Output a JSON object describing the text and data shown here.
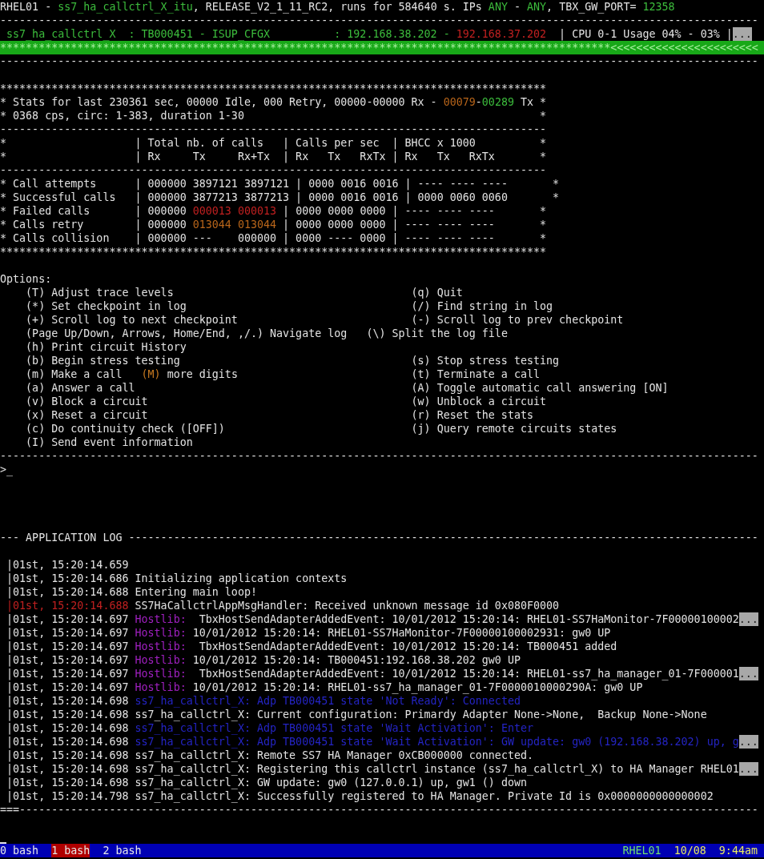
{
  "lines": [
    {
      "kind": "header",
      "segments": [
        {
          "text": "RHEL01 - "
        },
        {
          "text": "ss7_ha_callctrl_X_itu",
          "color": "#3cbc3c"
        },
        {
          "text": ", RELEASE_V2_1_11_RC2, runs for 584640 s. IPs "
        },
        {
          "text": "ANY",
          "color": "#3cbc3c"
        },
        {
          "text": " - "
        },
        {
          "text": "ANY",
          "color": "#3cbc3c"
        },
        {
          "text": ", TBX_GW_PORT= "
        },
        {
          "text": "12358",
          "color": "#3cbc3c"
        }
      ]
    },
    {
      "kind": "separator",
      "segments": [
        {
          "text": "----------------------------------------------------------------------------------------------------------------------"
        }
      ]
    },
    {
      "kind": "status",
      "segments": [
        {
          "text": "ss7_ha_callctrl_X  : TB000451 - ISUP_CFGX",
          "color": "#3cbc3c"
        },
        {
          "text": "          : 192.168.38.202 - ",
          "color": "#3cbc3c"
        },
        {
          "text": "192.168.37.202",
          "color": "#c02020"
        },
        {
          "text": "  | CPU 0-1 Usage 04% - 03% |"
        }
      ],
      "more": "..."
    },
    {
      "kind": "banner",
      "segments": [
        {
          "text": "***********************************************************************************************<<<<<<<<<<<<<<<<<<<<<<<"
        }
      ]
    },
    {
      "kind": "separator",
      "segments": [
        {
          "text": "----------------------------------------------------------------------------------------------------------------------"
        }
      ]
    },
    {
      "kind": "blank"
    },
    {
      "kind": "border",
      "segments": [
        {
          "text": "*************************************************************************************"
        }
      ]
    },
    {
      "kind": "stats",
      "segments": [
        {
          "text": "* Stats for last 230361 sec, 00000 Idle, 000 Retry, 00000-00000 Rx - "
        },
        {
          "text": "00079",
          "color": "#b8651a"
        },
        {
          "text": "-"
        },
        {
          "text": "00289",
          "color": "#3cbc3c"
        },
        {
          "text": " Tx *"
        }
      ]
    },
    {
      "kind": "stats",
      "segments": [
        {
          "text": "* 0368 cps, circ: 1-383, duration 1-30                                              *"
        }
      ]
    },
    {
      "kind": "separator",
      "segments": [
        {
          "text": "-------------------------------------------------------------------------------------"
        }
      ]
    },
    {
      "kind": "table_header",
      "segments": [
        {
          "text": "*                    | Total nb. of calls   | Calls per sec  | BHCC x 1000          *"
        }
      ]
    },
    {
      "kind": "table_header",
      "segments": [
        {
          "text": "*                    | Rx     Tx     Rx+Tx  | Rx   Tx   RxTx | Rx   Tx   RxTx       *"
        }
      ]
    },
    {
      "kind": "separator",
      "segments": [
        {
          "text": "-------------------------------------------------------------------------------------"
        }
      ]
    },
    {
      "kind": "table_row",
      "segments": [
        {
          "text": "* Call attempts      | 000000 3897121 3897121 | 0000 0016 0016 | ---- ---- ----       *"
        }
      ]
    },
    {
      "kind": "table_row",
      "segments": [
        {
          "text": "* Successful calls   | 000000 3877213 3877213 | 0000 0016 0016 | 0000 0060 0060       *"
        }
      ]
    },
    {
      "kind": "table_row",
      "segments": [
        {
          "text": "* Failed calls       | 000000 "
        },
        {
          "text": "000013 000013",
          "color": "#c02020"
        },
        {
          "text": " | 0000 0000 0000 | ---- ---- ----       *"
        }
      ]
    },
    {
      "kind": "table_row",
      "segments": [
        {
          "text": "* Calls retry        | 000000 "
        },
        {
          "text": "013044 013044",
          "color": "#b8651a"
        },
        {
          "text": " | 0000 0000 0000 | ---- ---- ----       *"
        }
      ]
    },
    {
      "kind": "table_row",
      "segments": [
        {
          "text": "* Calls collision    | 000000 ---    000000 | 0000 ---- 0000 | ---- ---- ----       *"
        }
      ]
    },
    {
      "kind": "border",
      "segments": [
        {
          "text": "*************************************************************************************"
        }
      ]
    },
    {
      "kind": "blank"
    },
    {
      "kind": "options_title",
      "segments": [
        {
          "text": "Options:"
        }
      ]
    },
    {
      "kind": "option",
      "left": [
        [
          {
            "text": "(T) Adjust trace levels"
          }
        ]
      ],
      "right": [
        [
          {
            "text": "(q) Quit"
          }
        ]
      ]
    },
    {
      "kind": "option",
      "left": [
        [
          {
            "text": "(*) Set checkpoint in log"
          }
        ]
      ],
      "right": [
        [
          {
            "text": "(/) Find string in log"
          }
        ]
      ]
    },
    {
      "kind": "option",
      "left": [
        [
          {
            "text": "(+) Scroll log to next checkpoint"
          }
        ]
      ],
      "right": [
        [
          {
            "text": "(-) Scroll log to prev checkpoint"
          }
        ]
      ]
    },
    {
      "kind": "option",
      "left": [
        [
          {
            "text": "(Page Up/Down, Arrows, Home/End, ,/.) Navigate log"
          }
        ],
        [
          {
            "text": "(\\) Split the log file"
          }
        ]
      ]
    },
    {
      "kind": "option",
      "left": [
        [
          {
            "text": "(h) Print circuit History"
          }
        ]
      ]
    },
    {
      "kind": "option",
      "left": [
        [
          {
            "text": "(b) Begin stress testing"
          }
        ]
      ],
      "right": [
        [
          {
            "text": "(s) Stop stress testing"
          }
        ]
      ]
    },
    {
      "kind": "option",
      "left": [
        [
          {
            "text": "(m) Make a call"
          }
        ],
        [
          {
            "text": "(M)",
            "color": "#c87a20"
          },
          {
            "text": " more digits"
          }
        ]
      ],
      "right": [
        [
          {
            "text": "(t) Terminate a call"
          }
        ]
      ]
    },
    {
      "kind": "option",
      "left": [
        [
          {
            "text": "(a) Answer a call"
          }
        ]
      ],
      "right": [
        [
          {
            "text": "(A) Toggle automatic call answering [ON]"
          }
        ]
      ]
    },
    {
      "kind": "option",
      "left": [
        [
          {
            "text": "(v) Block a circuit"
          }
        ]
      ],
      "right": [
        [
          {
            "text": "(w) Unblock a circuit"
          }
        ]
      ]
    },
    {
      "kind": "option",
      "left": [
        [
          {
            "text": "(x) Reset a circuit"
          }
        ]
      ],
      "right": [
        [
          {
            "text": "(r) Reset the stats"
          }
        ]
      ]
    },
    {
      "kind": "option",
      "left": [
        [
          {
            "text": "(c) Do continuity check ([OFF])"
          }
        ]
      ],
      "right": [
        [
          {
            "text": "(j) Query remote circuits states"
          }
        ]
      ]
    },
    {
      "kind": "option",
      "left": [
        [
          {
            "text": "(I) Send event information"
          }
        ]
      ]
    },
    {
      "kind": "separator",
      "segments": [
        {
          "text": "----------------------------------------------------------------------------------------------------------------------"
        }
      ]
    },
    {
      "kind": "prompt",
      "segments": [
        {
          "text": ">_"
        }
      ]
    },
    {
      "kind": "blank"
    },
    {
      "kind": "blank"
    },
    {
      "kind": "blank"
    },
    {
      "kind": "blank"
    },
    {
      "kind": "log_title",
      "segments": [
        {
          "text": "--- APPLICATION LOG --------------------------------------------------------------------------------------------------"
        }
      ]
    },
    {
      "kind": "blank"
    },
    {
      "kind": "log",
      "segments": [
        {
          "text": "|01st, 15:20:14.659"
        }
      ]
    },
    {
      "kind": "log",
      "segments": [
        {
          "text": "|01st, 15:20:14.686 Initializing application contexts"
        }
      ]
    },
    {
      "kind": "log",
      "segments": [
        {
          "text": "|01st, 15:20:14.688 Entering main loop!"
        }
      ]
    },
    {
      "kind": "log",
      "segments": [
        {
          "text": "|01st, 15:20:14.688",
          "color": "#c02020"
        },
        {
          "text": " SS7HaCallctrlAppMsgHandler: Received unknown message id 0x080F0000"
        }
      ]
    },
    {
      "kind": "log",
      "segments": [
        {
          "text": "|01st, 15:20:14.697 "
        },
        {
          "text": "Hostlib:",
          "color": "#a020c0"
        },
        {
          "text": "  TbxHostSendAdapterAddedEvent: 10/01/2012 15:20:14: RHEL01-SS7HaMonitor-7F00000100002"
        }
      ],
      "more": "..."
    },
    {
      "kind": "log",
      "segments": [
        {
          "text": "|01st, 15:20:14.697 "
        },
        {
          "text": "Hostlib:",
          "color": "#a020c0"
        },
        {
          "text": " 10/01/2012 15:20:14: RHEL01-SS7HaMonitor-7F00000100002931: gw0 UP"
        }
      ]
    },
    {
      "kind": "log",
      "segments": [
        {
          "text": "|01st, 15:20:14.697 "
        },
        {
          "text": "Hostlib:",
          "color": "#a020c0"
        },
        {
          "text": "  TbxHostSendAdapterAddedEvent: 10/01/2012 15:20:14: TB000451 added"
        }
      ]
    },
    {
      "kind": "log",
      "segments": [
        {
          "text": "|01st, 15:20:14.697 "
        },
        {
          "text": "Hostlib:",
          "color": "#a020c0"
        },
        {
          "text": " 10/01/2012 15:20:14: TB000451:192.168.38.202 gw0 UP"
        }
      ]
    },
    {
      "kind": "log",
      "segments": [
        {
          "text": "|01st, 15:20:14.697 "
        },
        {
          "text": "Hostlib:",
          "color": "#a020c0"
        },
        {
          "text": "  TbxHostSendAdapterAddedEvent: 10/01/2012 15:20:14: RHEL01-ss7_ha_manager_01-7F000001"
        }
      ],
      "more": "..."
    },
    {
      "kind": "log",
      "segments": [
        {
          "text": "|01st, 15:20:14.697 "
        },
        {
          "text": "Hostlib:",
          "color": "#a020c0"
        },
        {
          "text": " 10/01/2012 15:20:14: RHEL01-ss7_ha_manager_01-7F0000010000290A: gw0 UP"
        }
      ]
    },
    {
      "kind": "log",
      "segments": [
        {
          "text": "|01st, 15:20:14.698 "
        },
        {
          "text": "ss7_ha_callctrl_X: Adp TB000451 state 'Not Ready': Connected",
          "color": "#2424c4"
        }
      ]
    },
    {
      "kind": "log",
      "segments": [
        {
          "text": "|01st, 15:20:14.698 ss7_ha_callctrl_X: Current configuration: Primardy Adapter None->None,  Backup None->None"
        }
      ]
    },
    {
      "kind": "log",
      "segments": [
        {
          "text": "|01st, 15:20:14.698 "
        },
        {
          "text": "ss7_ha_callctrl_X: Adp TB000451 state 'Wait Activation': Enter",
          "color": "#2424c4"
        }
      ]
    },
    {
      "kind": "log",
      "segments": [
        {
          "text": "|01st, 15:20:14.698 "
        },
        {
          "text": "ss7_ha_callctrl_X: Adp TB000451 state 'Wait Activation': GW update: gw0 (192.168.38.202) up, g",
          "color": "#2424c4"
        }
      ],
      "more": "..."
    },
    {
      "kind": "log",
      "segments": [
        {
          "text": "|01st, 15:20:14.698 ss7_ha_callctrl_X: Remote SS7 HA Manager 0xCB000000 connected."
        }
      ]
    },
    {
      "kind": "log",
      "segments": [
        {
          "text": "|01st, 15:20:14.698 ss7_ha_callctrl_X: Registering this callctrl instance (ss7_ha_callctrl_X) to HA Manager RHEL01"
        }
      ],
      "more": "..."
    },
    {
      "kind": "log",
      "segments": [
        {
          "text": "|01st, 15:20:14.698 ss7_ha_callctrl_X: GW update: gw0 (127.0.0.1) up, gw1 () down"
        }
      ]
    },
    {
      "kind": "log",
      "segments": [
        {
          "text": "|01st, 15:20:14.798 ss7_ha_callctrl_X: Successfully registered to HA Manager. Private Id is 0x0000000000000002"
        }
      ]
    },
    {
      "kind": "log_end",
      "segments": [
        {
          "text": "===-------------------------------------------------------------------------------------------------------------------"
        }
      ]
    }
  ],
  "status_bar": {
    "windows": [
      {
        "label": "0 bash",
        "selected": false
      },
      {
        "label": "1 bash",
        "selected": true
      },
      {
        "label": "2 bash",
        "selected": false
      }
    ],
    "host": "RHEL01",
    "date": "10/08",
    "time": "9:44am"
  }
}
